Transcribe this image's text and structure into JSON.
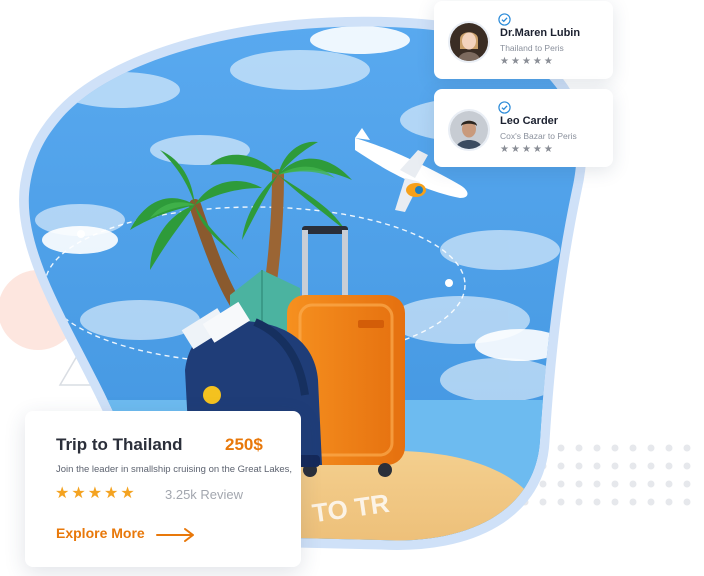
{
  "reviews": [
    {
      "name": "Dr.Maren Lubin",
      "route": "Thailand to Peris",
      "rating": 5
    },
    {
      "name": "Leo Carder",
      "route": "Cox's Bazar to Peris",
      "rating": 5
    }
  ],
  "trip_card": {
    "title": "Trip to Thailand",
    "price": "250$",
    "description": "Join the leader in smallship cruising on the Great Lakes,",
    "rating": 5,
    "reviews": "3.25k Review",
    "explore_label": "Explore More"
  },
  "illustration": {
    "sign_text": "TO TR"
  },
  "colors": {
    "accent": "#e8780a",
    "sky": "#58a7e8",
    "blob_border": "#cfe1f8",
    "star": "#f4a321",
    "verified": "#2a8ad8",
    "suitcase": "#f5851f"
  },
  "icons": [
    "verified-check-icon",
    "star-icon",
    "arrow-right-icon"
  ]
}
